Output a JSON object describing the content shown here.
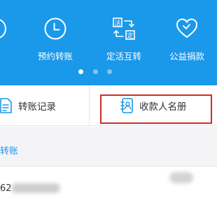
{
  "features": [
    {
      "label": "账",
      "icon": "partial-circle-icon"
    },
    {
      "label": "预约转账",
      "icon": "clock-icon"
    },
    {
      "label": "定活互转",
      "icon": "fixed-current-swap-icon"
    },
    {
      "label": "公益捐款",
      "icon": "heart-icon"
    }
  ],
  "swap_icon_glyphs": {
    "top": "活",
    "bottom": "定"
  },
  "carousel": {
    "pages": 3,
    "active_index": 0
  },
  "actions": {
    "history_label": "转账记录",
    "payees_label": "收款人名册"
  },
  "recent": {
    "title": "转账",
    "record_prefix": "62"
  },
  "colors": {
    "banner": "#1a98ea",
    "highlight_box": "#d22a2a",
    "link_blue": "#1a98ea"
  }
}
